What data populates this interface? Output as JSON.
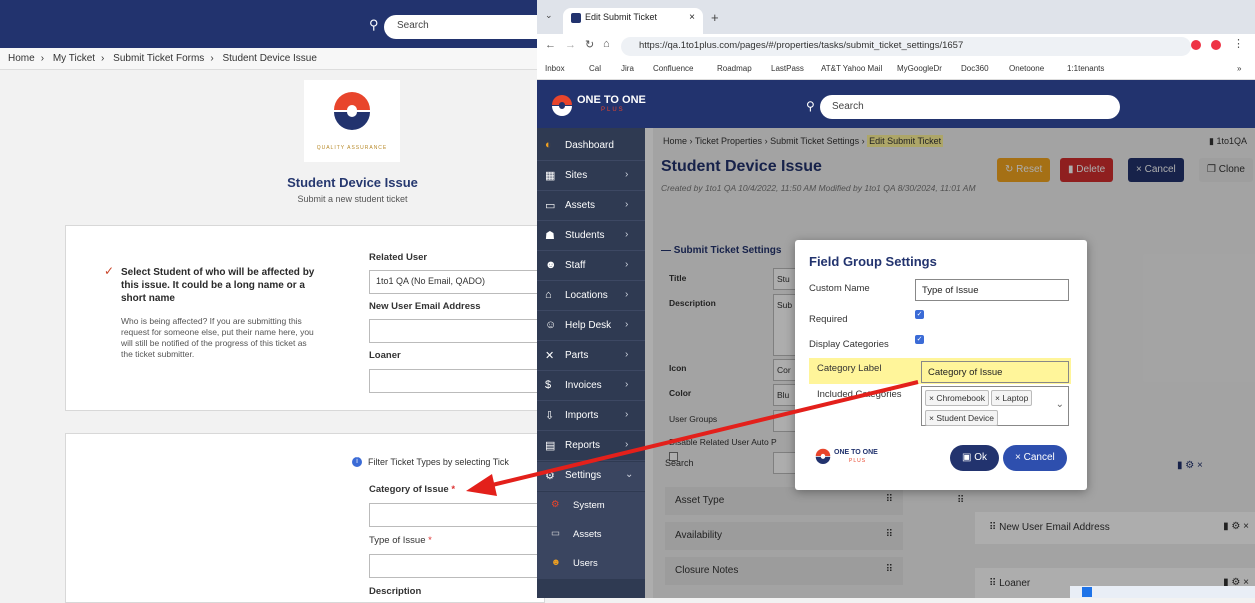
{
  "left_app": {
    "search_placeholder": "Search",
    "breadcrumb": [
      "Home",
      "My Ticket",
      "Submit Ticket Forms",
      "Student Device Issue"
    ],
    "logo_caption": "QUALITY ASSURANCE",
    "title": "Student Device Issue",
    "subtitle": "Submit a new student ticket",
    "card1": {
      "heading": "Select Student of who will be affected by this issue. It could be a long name or a short name",
      "help": "Who is being affected? If you are submitting this request for someone else, put their name here, you will still be notified of the progress of this ticket as the ticket submitter.",
      "related_user_label": "Related User",
      "related_user_value": "1to1 QA (No Email, QADO)",
      "new_email_label": "New User Email Address",
      "loaner_label": "Loaner"
    },
    "card2": {
      "info": "Filter Ticket Types by selecting Tick",
      "category_label": "Category of Issue",
      "type_label": "Type of Issue",
      "description_label": "Description",
      "required_mark": "*"
    }
  },
  "browser": {
    "tab_title": "Edit Submit Ticket",
    "url": "https://qa.1to1plus.com/pages/#/properties/tasks/submit_ticket_settings/1657",
    "bookmarks": [
      "Inbox",
      "Cal",
      "Jira",
      "Confluence",
      "Roadmap",
      "LastPass",
      "AT&T Yahoo Mail",
      "MyGoogleDr",
      "Doc360",
      "Onetoone",
      "1:1tenants"
    ],
    "more": "»"
  },
  "inner_app": {
    "logo_text": "ONE TO ONE",
    "logo_sub": "PLUS",
    "search_placeholder": "Search",
    "sidebar": [
      {
        "label": "Dashboard",
        "icon": "dashboard-icon"
      },
      {
        "label": "Sites",
        "icon": "sites-icon"
      },
      {
        "label": "Assets",
        "icon": "assets-icon"
      },
      {
        "label": "Students",
        "icon": "students-icon"
      },
      {
        "label": "Staff",
        "icon": "staff-icon"
      },
      {
        "label": "Locations",
        "icon": "locations-icon"
      },
      {
        "label": "Help Desk",
        "icon": "help-desk-icon"
      },
      {
        "label": "Parts",
        "icon": "parts-icon"
      },
      {
        "label": "Invoices",
        "icon": "invoices-icon"
      },
      {
        "label": "Imports",
        "icon": "imports-icon"
      },
      {
        "label": "Reports",
        "icon": "reports-icon"
      },
      {
        "label": "Settings",
        "icon": "settings-icon"
      }
    ],
    "sidebar_sub": [
      "System",
      "Assets",
      "Users"
    ],
    "breadcrumb": [
      "Home",
      "Ticket Properties",
      "Submit Ticket Settings",
      "Edit Submit Ticket"
    ],
    "user": "1to1QA",
    "title": "Student Device Issue",
    "meta": "Created by 1to1 QA 10/4/2022, 11:50 AM   Modified by 1to1 QA 8/30/2024, 11:01 AM",
    "buttons": {
      "reset": "Reset",
      "delete": "Delete",
      "cancel": "Cancel",
      "clone": "Clone"
    },
    "section": "Submit Ticket Settings",
    "fields": {
      "title": "Title",
      "description": "Description",
      "icon": "Icon",
      "color": "Color",
      "user_groups": "User Groups",
      "disable_related": "Disable Related User Auto P"
    },
    "field_values": {
      "title": "Stu",
      "description": "Sub",
      "icon": "Cor",
      "color": "Blu"
    },
    "search_label": "Search",
    "left_list": [
      "Asset Type",
      "Availability",
      "Closure Notes"
    ],
    "right_list": [
      "New User Email Address",
      "Loaner"
    ]
  },
  "modal": {
    "title": "Field Group Settings",
    "custom_name_label": "Custom Name",
    "custom_name_value": "Type of Issue",
    "required_label": "Required",
    "display_categories_label": "Display Categories",
    "category_label_label": "Category Label",
    "category_label_value": "Category of Issue",
    "included_categories_label": "Included Categories",
    "categories": [
      "Chromebook",
      "Laptop",
      "Student Device"
    ],
    "ok": "Ok",
    "cancel": "Cancel",
    "highlight_color": "#fff59a",
    "arrow_color": "#e3201b"
  }
}
